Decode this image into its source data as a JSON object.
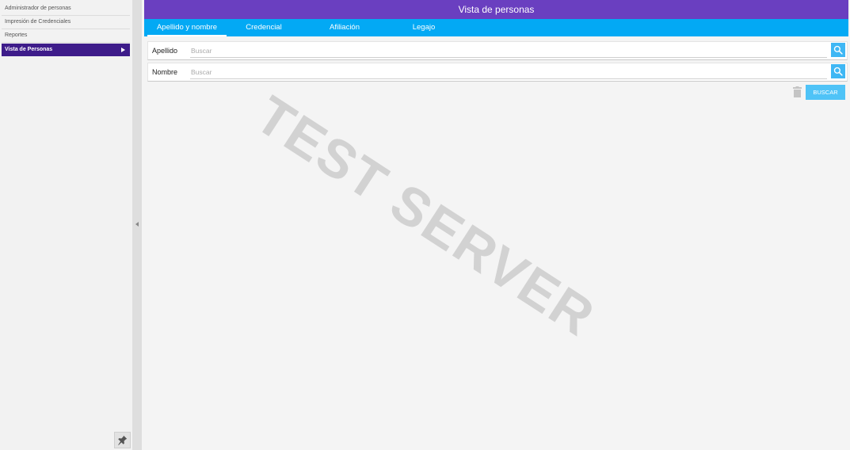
{
  "sidebar": {
    "items": [
      {
        "label": "Administrador de personas",
        "active": false
      },
      {
        "label": "Impresión de Credenciales",
        "active": false
      },
      {
        "label": "Reportes",
        "active": false
      },
      {
        "label": "Vista de Personas",
        "active": true
      }
    ],
    "pin_icon": "pin-icon"
  },
  "main": {
    "title": "Vista de personas",
    "tabs": [
      {
        "label": "Apellido y nombre",
        "active": true
      },
      {
        "label": "Credencial",
        "active": false
      },
      {
        "label": "Afiliación",
        "active": false
      },
      {
        "label": "Legajo",
        "active": false
      }
    ],
    "fields": [
      {
        "label": "Apellido",
        "placeholder": "Buscar",
        "value": ""
      },
      {
        "label": "Nombre",
        "placeholder": "Buscar",
        "value": ""
      }
    ],
    "buscar_label": "BUSCAR",
    "trash_icon": "trash-icon",
    "search_icon": "search-icon"
  },
  "watermark": "TEST SERVER",
  "colors": {
    "title_bar": "#6a3fc0",
    "tab_bar": "#03a9f4",
    "sidebar_active": "#3e1c8a",
    "button": "#4fc3f7"
  }
}
